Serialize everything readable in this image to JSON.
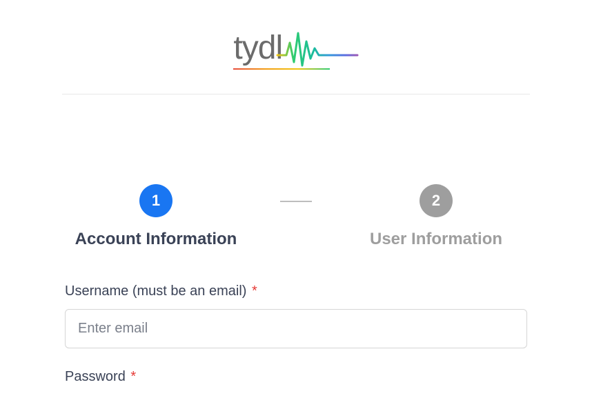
{
  "logo": {
    "text": "tydl"
  },
  "steps": [
    {
      "num": "1",
      "title": "Account Information",
      "active": true
    },
    {
      "num": "2",
      "title": "User Information",
      "active": false
    }
  ],
  "form": {
    "username": {
      "label": "Username (must be an email)",
      "placeholder": "Enter email",
      "required": "*"
    },
    "password": {
      "label": "Password",
      "required": "*"
    }
  }
}
